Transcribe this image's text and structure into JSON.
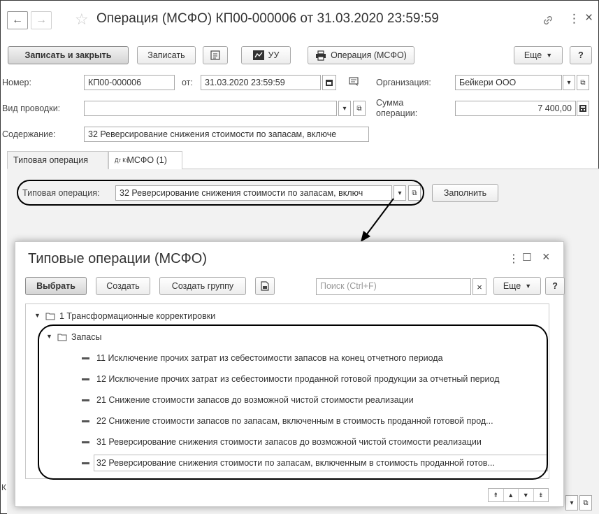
{
  "window": {
    "title": "Операция (МСФО) КП00-000006 от 31.03.2020 23:59:59",
    "back_glyph": "←",
    "forward_glyph": "→",
    "star_glyph": "☆",
    "link_glyph": "🔗",
    "menu_glyph": "⋮",
    "close_glyph": "×"
  },
  "toolbar": {
    "save_close": "Записать и закрыть",
    "save": "Записать",
    "uu": "УУ",
    "operation": "Операция (МСФО)",
    "more": "Еще",
    "help": "?"
  },
  "form": {
    "number_label": "Номер:",
    "number_value": "КП00-000006",
    "from_label": "от:",
    "date_value": "31.03.2020 23:59:59",
    "org_label": "Организация:",
    "org_value": "Бейкери ООО",
    "type_label": "Вид проводки:",
    "type_value": "",
    "sum_label_1": "Сумма",
    "sum_label_2": "операции:",
    "sum_value": "7 400,00",
    "content_label": "Содержание:",
    "content_value": "32 Реверсирование снижения стоимости по запасам, включе"
  },
  "tabs": {
    "typical": "Типовая операция",
    "ifrs_icon": "Дт Кт",
    "ifrs": "МСФО (1)"
  },
  "typical": {
    "label": "Типовая операция:",
    "value": "32 Реверсирование снижения стоимости по запасам, включ",
    "fill_button": "Заполнить"
  },
  "dialog": {
    "title": "Типовые операции (МСФО)",
    "select": "Выбрать",
    "create": "Создать",
    "create_group": "Создать группу",
    "search_placeholder": "Поиск (Ctrl+F)",
    "more": "Еще",
    "help": "?",
    "menu_glyph": "⋮",
    "maximize_glyph": "☐",
    "close_glyph": "×",
    "tree": {
      "group": "1 Трансформационные корректировки",
      "subgroup": "Запасы",
      "items": [
        "11 Исключение прочих затрат из себестоимости запасов на конец отчетного периода",
        "12 Исключение прочих затрат из себестоимости проданной готовой продукции за отчетный период",
        "21 Снижение стоимости запасов до возможной чистой стоимости реализации",
        "22 Снижение стоимости запасов по запасам, включенным в стоимость проданной готовой прод...",
        "31 Реверсирование снижения стоимости запасов до возможной чистой стоимости реализации",
        "32 Реверсирование снижения стоимости по запасам, включенным в стоимость проданной готов..."
      ]
    }
  },
  "colors": {
    "accent_border": "#000000",
    "selected_row": "#ffffff",
    "tab_active": "#ffffff",
    "panel_bg": "#f2f2f2"
  }
}
